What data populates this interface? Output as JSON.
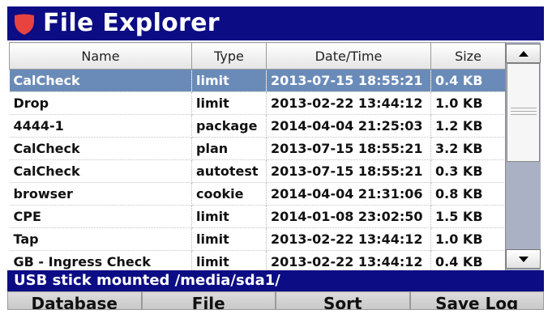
{
  "titlebar": {
    "title": "File Explorer",
    "logo_icon": "shield-logo",
    "bg_color": "#0c0c84"
  },
  "table": {
    "columns": [
      "Name",
      "Type",
      "Date/Time",
      "Size"
    ],
    "selected_row": 0,
    "rows": [
      {
        "name": "CalCheck",
        "type": "limit",
        "datetime": "2013-07-15 18:55:21",
        "size": "0.4 KB"
      },
      {
        "name": "Drop",
        "type": "limit",
        "datetime": "2013-02-22 13:44:12",
        "size": "1.0 KB"
      },
      {
        "name": "4444-1",
        "type": "package",
        "datetime": "2014-04-04 21:25:03",
        "size": "1.2 KB"
      },
      {
        "name": "CalCheck",
        "type": "plan",
        "datetime": "2013-07-15 18:55:21",
        "size": "3.2 KB"
      },
      {
        "name": "CalCheck",
        "type": "autotest",
        "datetime": "2013-07-15 18:55:21",
        "size": "0.3 KB"
      },
      {
        "name": "browser",
        "type": "cookie",
        "datetime": "2014-04-04 21:31:06",
        "size": "0.8 KB"
      },
      {
        "name": "CPE",
        "type": "limit",
        "datetime": "2014-01-08 23:02:50",
        "size": "1.5 KB"
      },
      {
        "name": "Tap",
        "type": "limit",
        "datetime": "2013-02-22 13:44:12",
        "size": "1.0 KB"
      },
      {
        "name": "GB - Ingress Check",
        "type": "limit",
        "datetime": "2013-02-22 13:44:12",
        "size": "0.4 KB"
      }
    ]
  },
  "scrollbar": {
    "up_icon": "arrow-up-icon",
    "down_icon": "arrow-down-icon"
  },
  "status": {
    "text": "USB stick mounted /media/sda1/"
  },
  "softkeys": [
    "Database",
    "File",
    "Sort",
    "Save Log"
  ],
  "colors": {
    "selection": "#6a8bb8",
    "scroll_track": "#aab1c4",
    "logo_red": "#e8433f"
  }
}
